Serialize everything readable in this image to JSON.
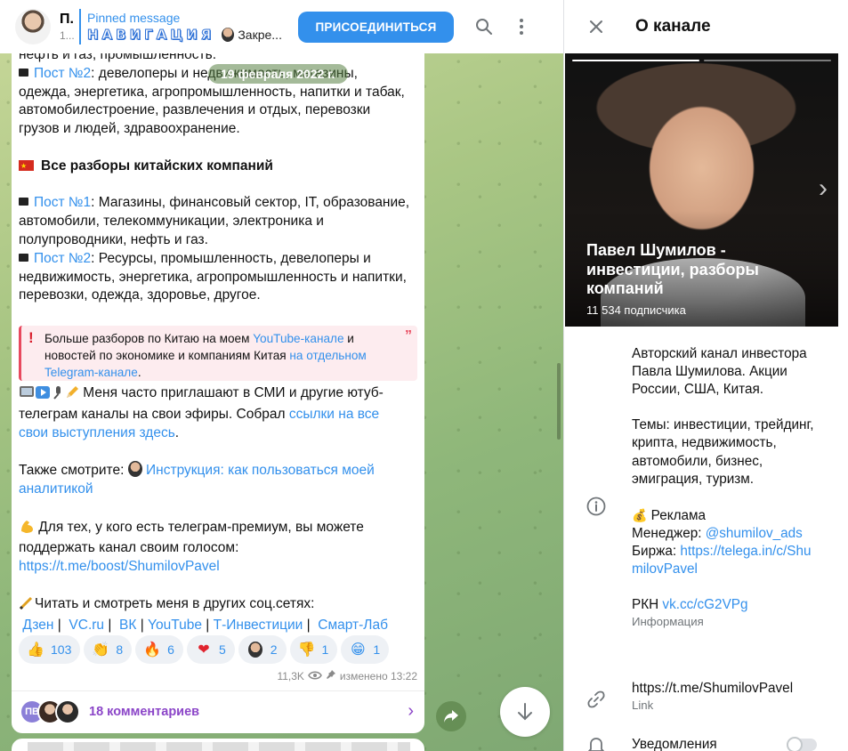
{
  "chat_header": {
    "channel_name": "П.",
    "channel_sub": "1...",
    "pinned_label": "Pinned message",
    "pinned_nav": "НАВИГАЦИЯ",
    "pinned_text": "Закре...",
    "join_label": "ПРИСОЕДИНИТЬСЯ"
  },
  "date_pill": "19 февраля 2022 г.",
  "message": {
    "line_top": "нефть и газ, промышленность.",
    "post2_link": "Пост №2",
    "post2_text": ":  девелоперы и недвижимость, магазины, одежда, энергетика, агропромышленность, напитки и табак, автомобилестроение, развлечения и отдых, перевозки грузов и людей, здравоохранение.",
    "china_heading": "Все разборы китайских компаний",
    "c_post1_link": "Пост №1",
    "c_post1_text": ": Магазины, финансовый сектор, IT, образование, автомобили, телекоммуникации, электроника и полупроводники, нефть и газ.",
    "c_post2_link": "Пост №2",
    "c_post2_text": ": Ресурсы, промышленность, девелоперы и недвижимость, энергетика, агропромышленность и напитки, перевозки, одежда, здоровье, другое.",
    "quote_text1": "Больше разборов по Китаю на моем ",
    "quote_link1": "YouTube-канале",
    "quote_text2": " и новостей по экономике и компаниям Китая ",
    "quote_link2": "на отдельном Telegram-канале",
    "quote_text3": ".",
    "media_text": " Меня часто приглашают в СМИ и другие ютуб-телеграм каналы на свои эфиры. Собрал ",
    "media_link": "ссылки на все свои выступления здесь",
    "media_end": ".",
    "also_text": "Также смотрите: ",
    "also_link": "Инструкция: как пользоваться моей аналитикой",
    "premium_text": " Для тех, у кого есть телеграм-премиум, вы можете поддержать канал своим голосом:",
    "premium_link": "https://t.me/boost/ShumilovPavel",
    "social_text": "Читать и смотреть меня в других соц.сетях:",
    "social_links": [
      "Дзен",
      "VC.ru",
      "ВК",
      "YouTube",
      "Т-Инвестиции",
      "Смарт-Лаб"
    ],
    "social_sep": "|"
  },
  "reactions": [
    {
      "emoji": "👍",
      "count": "103"
    },
    {
      "emoji": "👏",
      "count": "8"
    },
    {
      "emoji": "🔥",
      "count": "6"
    },
    {
      "emoji": "❤",
      "count": "5"
    },
    {
      "emoji": "face",
      "count": "2"
    },
    {
      "emoji": "👎",
      "count": "1"
    },
    {
      "emoji": "😁",
      "count": "1"
    }
  ],
  "meta": {
    "views": "11,3K",
    "edited": "изменено 13:22"
  },
  "comments": {
    "avatar_initials": "ПВ",
    "label": "18 комментариев"
  },
  "side_panel": {
    "title": "О канале",
    "photo_name": "Павел Шумилов - инвестиции, разборы компаний",
    "subscribers": "11 534 подписчика",
    "desc1": "Авторский канал инвестора Павла Шумилова. Акции России, США, Китая.",
    "desc2": "Темы: инвестиции, трейдинг, крипта, недвижимость, автомобили, бизнес, эмиграция, туризм.",
    "ad_label": " Реклама",
    "manager_label": "Менеджер: ",
    "manager_link": "@shumilov_ads",
    "exchange_label": "Биржа: ",
    "exchange_link": "https://telega.in/c/ShumilovPavel",
    "rkn_label": "РКН ",
    "rkn_link": "vk.cc/cG2VPg",
    "info_label": "Информация",
    "link_value": "https://t.me/ShumilovPavel",
    "link_label": "Link",
    "notifications_label": "Уведомления"
  }
}
